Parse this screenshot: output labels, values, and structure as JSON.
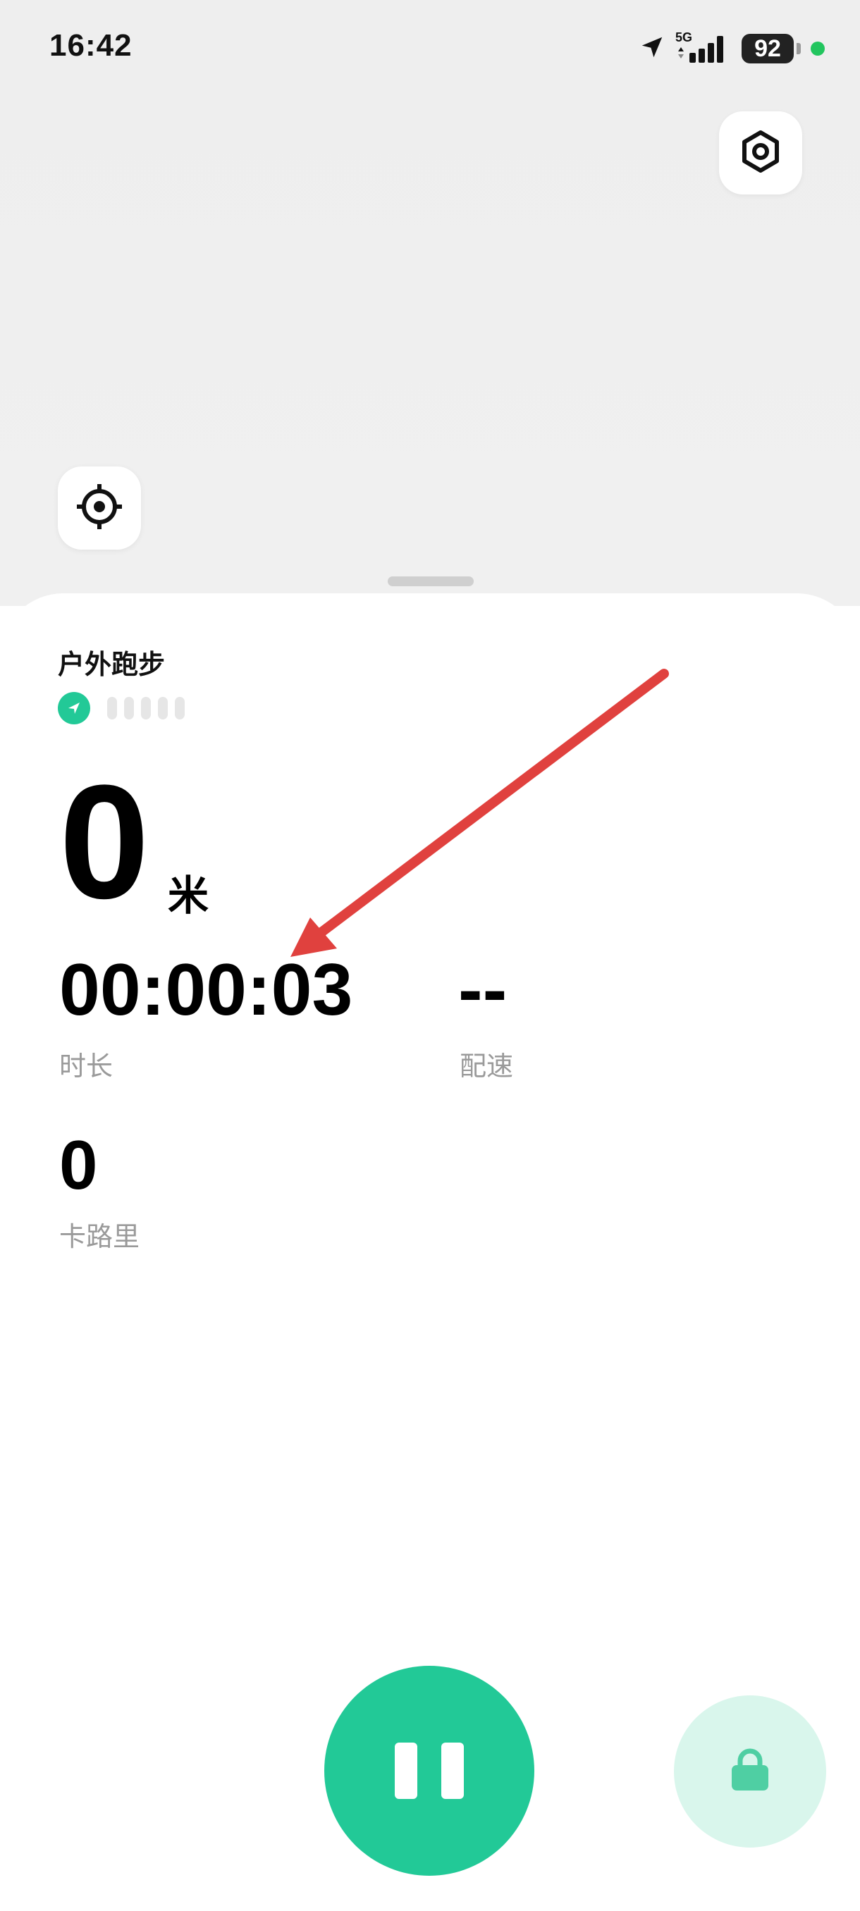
{
  "status_bar": {
    "time": "16:42",
    "network": "5G",
    "battery": "92",
    "icons": [
      "location-arrow-icon",
      "signal-bars-icon",
      "battery-icon",
      "privacy-dot-icon"
    ]
  },
  "map": {
    "settings_icon": "settings-hex-icon",
    "locate_icon": "crosshair-icon"
  },
  "workout": {
    "title": "户外跑步",
    "gps_icon": "gps-arrow-icon",
    "gps_signal_bars_filled": 0,
    "gps_signal_bars_total": 5,
    "distance_value": "0",
    "distance_unit": "米",
    "duration_value": "00:00:03",
    "duration_label": "时长",
    "pace_value": "--",
    "pace_label": "配速",
    "calories_value": "0",
    "calories_label": "卡路里"
  },
  "controls": {
    "pause_icon": "pause-icon",
    "lock_icon": "lock-icon"
  },
  "colors": {
    "accent": "#22c997",
    "lock_bg": "#d9f6ec",
    "annotation_arrow": "#e0413e"
  }
}
